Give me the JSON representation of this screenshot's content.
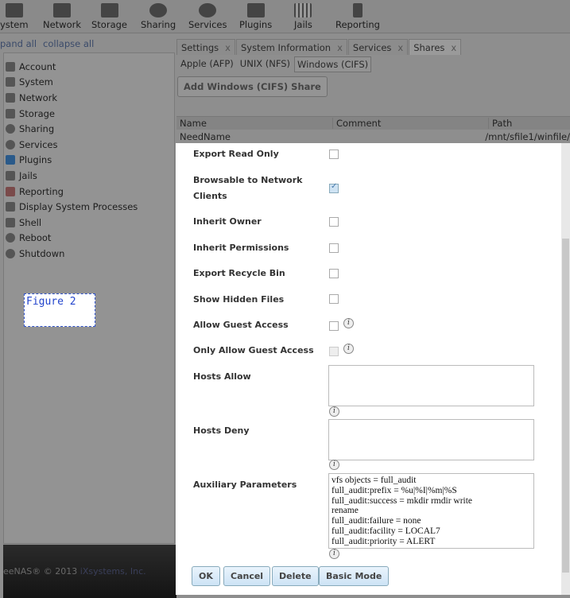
{
  "topnav": [
    {
      "label": "ystem",
      "icon": "system-icon"
    },
    {
      "label": "Network",
      "icon": "network-icon"
    },
    {
      "label": "Storage",
      "icon": "storage-icon"
    },
    {
      "label": "Sharing",
      "icon": "sharing-icon"
    },
    {
      "label": "Services",
      "icon": "services-icon"
    },
    {
      "label": "Plugins",
      "icon": "plugins-icon"
    },
    {
      "label": "Jails",
      "icon": "jails-icon"
    },
    {
      "label": "Reporting",
      "icon": "reporting-icon"
    }
  ],
  "tree": {
    "expand_all": "pand all",
    "collapse_all": "collapse all"
  },
  "sidebar": {
    "items": [
      {
        "label": "Account"
      },
      {
        "label": "System"
      },
      {
        "label": "Network"
      },
      {
        "label": "Storage"
      },
      {
        "label": "Sharing"
      },
      {
        "label": "Services"
      },
      {
        "label": "Plugins"
      },
      {
        "label": "Jails"
      },
      {
        "label": "Reporting"
      },
      {
        "label": "Display System Processes"
      },
      {
        "label": "Shell"
      },
      {
        "label": "Reboot"
      },
      {
        "label": "Shutdown"
      }
    ]
  },
  "annotation": "Figure 2",
  "footer": {
    "copyright": "eeNAS® © 2013",
    "company": "iXsystems, Inc."
  },
  "tabs": [
    {
      "label": "Settings"
    },
    {
      "label": "System Information"
    },
    {
      "label": "Services"
    },
    {
      "label": "Shares"
    }
  ],
  "close_glyph": "x",
  "subtabs": [
    {
      "label": "Apple (AFP)"
    },
    {
      "label": "UNIX (NFS)"
    },
    {
      "label": "Windows (CIFS)"
    }
  ],
  "add_button": "Add Windows (CIFS) Share",
  "grid": {
    "columns": [
      "Name",
      "Comment",
      "Path"
    ],
    "rows": [
      [
        "NeedName",
        "",
        "/mnt/sfile1/winfile/"
      ]
    ]
  },
  "form": {
    "export_read_only": {
      "label": "Export Read Only",
      "checked": false
    },
    "browsable": {
      "label": "Browsable to Network",
      "label2": "Clients",
      "checked": true
    },
    "inherit_owner": {
      "label": "Inherit Owner",
      "checked": false
    },
    "inherit_permissions": {
      "label": "Inherit Permissions",
      "checked": false
    },
    "export_recycle_bin": {
      "label": "Export Recycle Bin",
      "checked": false
    },
    "show_hidden_files": {
      "label": "Show Hidden Files",
      "checked": false
    },
    "allow_guest": {
      "label": "Allow Guest Access",
      "checked": false
    },
    "only_guest": {
      "label": "Only Allow Guest Access",
      "checked": false,
      "disabled": true
    },
    "hosts_allow": {
      "label": "Hosts Allow",
      "value": ""
    },
    "hosts_deny": {
      "label": "Hosts Deny",
      "value": ""
    },
    "aux": {
      "label": "Auxiliary Parameters",
      "value": "vfs objects = full_audit\nfull_audit:prefix = %u|%I|%m|%S\nfull_audit:success = mkdir rmdir write\nrename\nfull_audit:failure = none\nfull_audit:facility = LOCAL7\nfull_audit:priority = ALERT"
    }
  },
  "info_glyph": "i",
  "buttons": {
    "ok": "OK",
    "cancel": "Cancel",
    "delete": "Delete",
    "basic_mode": "Basic Mode"
  }
}
